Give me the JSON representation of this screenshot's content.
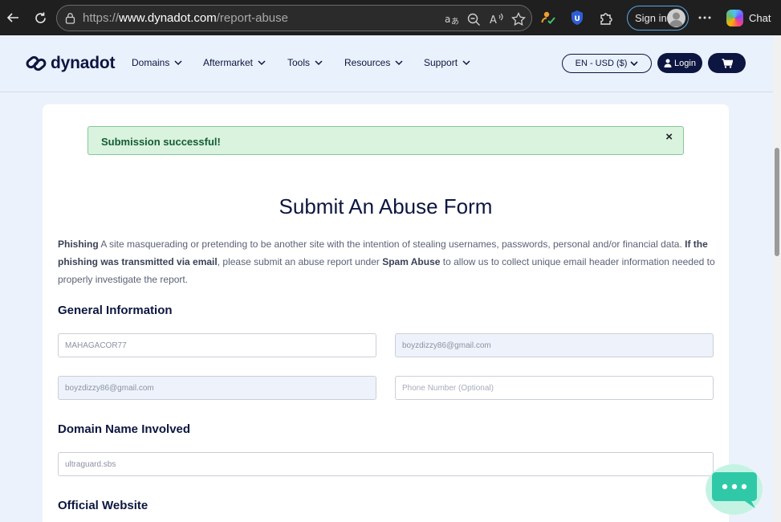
{
  "browser": {
    "url_prefix": "https://",
    "url_host": "www.dynadot.com",
    "url_path": "/report-abuse",
    "signin_label": "Sign in",
    "chat_label": "Chat"
  },
  "site": {
    "logo_text": "dynadot",
    "nav": [
      "Domains",
      "Aftermarket",
      "Tools",
      "Resources",
      "Support"
    ],
    "lang_label": "EN - USD ($)",
    "login_label": "Login"
  },
  "alert": {
    "message": "Submission successful!",
    "close_glyph": "×"
  },
  "page": {
    "title": "Submit An Abuse Form",
    "desc": {
      "t1": "Phishing",
      "t2": " A site masquerading or pretending to be another site with the intention of stealing usernames, passwords, personal and/or financial data. ",
      "t3": "If the phishing was transmitted via email",
      "t4": ", please submit an abuse report under ",
      "t5": "Spam Abuse",
      "t6": " to allow us to collect unique email header information needed to properly investigate the report."
    },
    "sections": {
      "general": "General Information",
      "domain": "Domain Name Involved",
      "website": "Official Website"
    },
    "fields": {
      "name": "MAHAGACOR77",
      "email": "boyzdizzy86@gmail.com",
      "email_confirm": "boyzdizzy86@gmail.com",
      "phone_placeholder": "Phone Number (Optional)",
      "domain": "ultraguard.sbs"
    }
  },
  "colors": {
    "brand_navy": "#0d1640",
    "success_bg": "#d9f3df",
    "success_text": "#155c31",
    "chat_teal": "#2fc9a8"
  }
}
